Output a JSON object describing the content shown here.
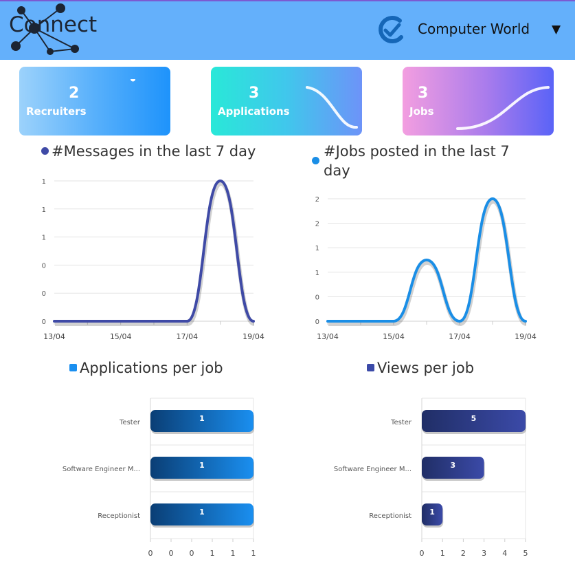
{
  "header": {
    "logo_text": "Connect",
    "company_name": "Computer World",
    "caret": "▼"
  },
  "cards": [
    {
      "value": "2",
      "label": "Recruiters"
    },
    {
      "value": "3",
      "label": "Applications"
    },
    {
      "value": "3",
      "label": "Jobs"
    }
  ],
  "colors": {
    "header_bg": "#64b0fb",
    "messages_series": "#3f4aa6",
    "jobs_series": "#1a8ee6",
    "applications_bar": "#1a8ff0",
    "views_bar": "#3b4aa8"
  },
  "chart_data": [
    {
      "type": "line",
      "title": "#Messages in the last 7 day",
      "x": [
        "13/04",
        "14/04",
        "15/04",
        "16/04",
        "17/04",
        "18/04",
        "19/04"
      ],
      "x_tick_labels": [
        "13/04",
        "15/04",
        "17/04",
        "19/04"
      ],
      "y_tick_labels": [
        "0",
        "0",
        "0",
        "1",
        "1",
        "1"
      ],
      "ylim": [
        0,
        1
      ],
      "series": [
        {
          "name": "#Messages in the last 7 day",
          "values": [
            0,
            0,
            0,
            0,
            0,
            1,
            0
          ]
        }
      ],
      "grid": true
    },
    {
      "type": "line",
      "title": "#Jobs posted in the last 7 day",
      "x": [
        "13/04",
        "14/04",
        "15/04",
        "16/04",
        "17/04",
        "18/04",
        "19/04"
      ],
      "x_tick_labels": [
        "13/04",
        "15/04",
        "17/04",
        "19/04"
      ],
      "y_tick_labels": [
        "0",
        "0",
        "1",
        "1",
        "2",
        "2"
      ],
      "ylim": [
        0,
        2
      ],
      "series": [
        {
          "name": "#Jobs posted in the last 7 day",
          "values": [
            0,
            0,
            0,
            1,
            0,
            2,
            0
          ]
        }
      ],
      "grid": true
    },
    {
      "type": "bar",
      "orientation": "horizontal",
      "title": "Applications per job",
      "categories": [
        "Tester",
        "Software Engineer M...",
        "Receptionist"
      ],
      "series": [
        {
          "name": "Applications per job",
          "values": [
            1,
            1,
            1
          ]
        }
      ],
      "x_tick_labels": [
        "0",
        "0",
        "0",
        "1",
        "1",
        "1"
      ],
      "xlim": [
        0,
        1
      ],
      "grid": true
    },
    {
      "type": "bar",
      "orientation": "horizontal",
      "title": "Views per job",
      "categories": [
        "Tester",
        "Software Engineer M...",
        "Receptionist"
      ],
      "series": [
        {
          "name": "Views per job",
          "values": [
            5,
            3,
            1
          ]
        }
      ],
      "x_tick_labels": [
        "0",
        "1",
        "2",
        "3",
        "4",
        "5"
      ],
      "xlim": [
        0,
        5
      ],
      "grid": true
    }
  ]
}
